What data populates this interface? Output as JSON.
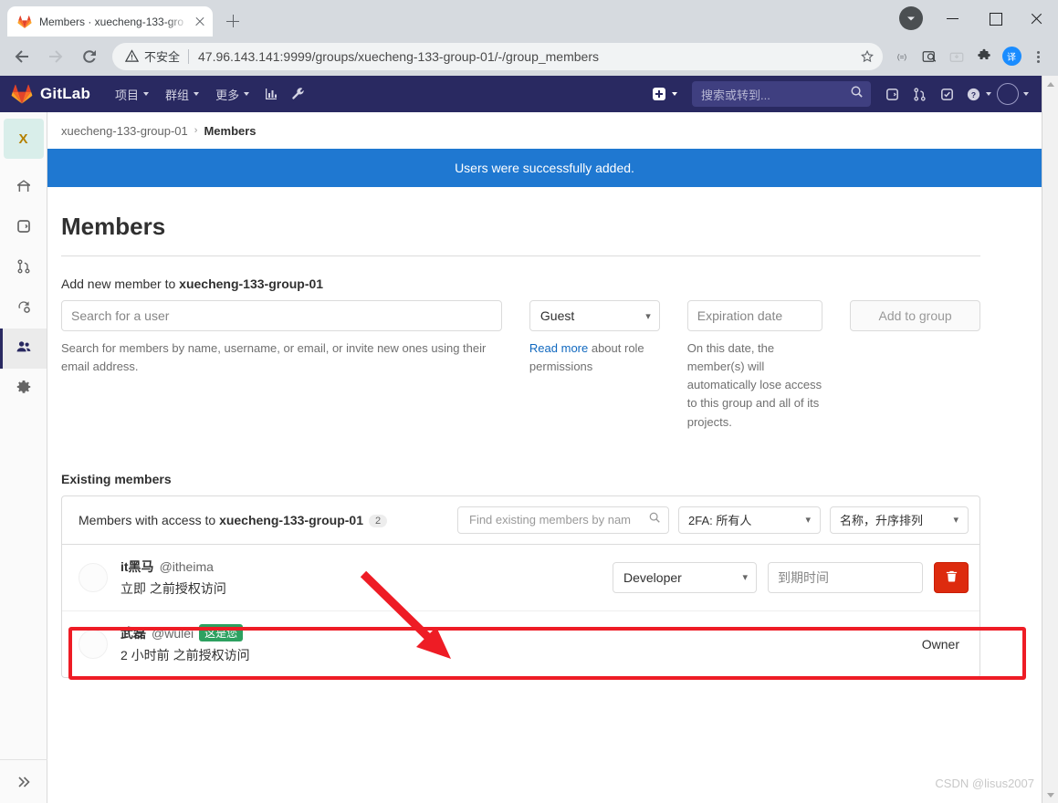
{
  "browser": {
    "tab": {
      "title": "Members · xuecheng-133-gro",
      "favicon": "gitlab-icon",
      "close": "close-icon"
    },
    "new_tab": "new-tab-icon",
    "window_controls": {
      "minimize": "minimize-icon",
      "maximize": "maximize-icon",
      "close": "close-icon"
    },
    "toolbar": {
      "back": "back-arrow-icon",
      "forward": "forward-arrow-icon",
      "reload": "reload-icon",
      "security_icon": "not-secure-warning-icon",
      "security_label": "不安全",
      "url": "47.96.143.141:9999/groups/xuecheng-133-group-01/-/group_members",
      "bookmark": "star-icon",
      "extensions": [
        "equalizer-icon",
        "screenshot-icon",
        "download-icon",
        "puzzle-icon",
        "translate-badge-icon"
      ],
      "menu": "kebab-menu-icon"
    }
  },
  "gitlab_nav": {
    "brand": "GitLab",
    "items": [
      {
        "label": "项目",
        "caret": true
      },
      {
        "label": "群组",
        "caret": true
      },
      {
        "label": "更多",
        "caret": true
      }
    ],
    "icon_buttons": [
      "analytics-icon",
      "wrench-icon"
    ],
    "create_new": "plus-icon",
    "search_placeholder": "搜索或转到...",
    "right_icons": [
      "issues-icon",
      "merge-requests-icon",
      "todos-icon",
      "help-icon"
    ],
    "avatar": "user-avatar"
  },
  "sidebar": {
    "context_initial": "X",
    "items": [
      {
        "name": "group-overview",
        "icon": "home-icon",
        "active": false
      },
      {
        "name": "issues",
        "icon": "issues-icon",
        "active": false
      },
      {
        "name": "merge-requests",
        "icon": "merge-request-icon",
        "active": false
      },
      {
        "name": "ci-cd",
        "icon": "pipeline-icon",
        "active": false
      },
      {
        "name": "members",
        "icon": "users-icon",
        "active": true
      },
      {
        "name": "settings",
        "icon": "gear-icon",
        "active": false
      }
    ],
    "collapse": "collapse-sidebar-icon"
  },
  "breadcrumb": {
    "group": "xuecheng-133-group-01",
    "separator": "›",
    "current": "Members"
  },
  "flash": {
    "message": "Users were successfully added."
  },
  "page": {
    "title": "Members",
    "add_member": {
      "label_prefix": "Add new member to ",
      "label_group": "xuecheng-133-group-01",
      "search_placeholder": "Search for a user",
      "search_value": "",
      "search_help": "Search for members by name, username, or email, or invite new ones using their email address.",
      "role_value": "Guest",
      "role_help_link": "Read more",
      "role_help_text": " about role permissions",
      "expiration_placeholder": "Expiration date",
      "expiration_value": "",
      "expiration_help": "On this date, the member(s) will automatically lose access to this group and all of its projects.",
      "submit_label": "Add to group"
    },
    "existing": {
      "section_title": "Existing members",
      "header_prefix": "Members with access to ",
      "header_group": "xuecheng-133-group-01",
      "count": "2",
      "find_placeholder": "Find existing members by nam",
      "find_value": "",
      "filter_2fa": "2FA: 所有人",
      "sort": "名称，升序排列",
      "members": [
        {
          "name": "it黑马",
          "handle": "@itheima",
          "you_badge": "",
          "access_text": "立即 之前授权访问",
          "role": "Developer",
          "expiration_placeholder": "到期时间",
          "expiration_value": "",
          "delete_icon": "trash-icon",
          "role_static": ""
        },
        {
          "name": "武磊",
          "handle": "@wulei",
          "you_badge": "这是您",
          "access_text": "2 小时前 之前授权访问",
          "role": "",
          "expiration_placeholder": "",
          "expiration_value": "",
          "delete_icon": "",
          "role_static": "Owner"
        }
      ]
    }
  },
  "watermark": "CSDN @lisus2007",
  "colors": {
    "gitlab_navy": "#292961",
    "flash_blue": "#1f78d1",
    "danger_red": "#dd2b0e",
    "annotation_red": "#ee1c25",
    "link_blue": "#1068bf",
    "badge_green": "#2da160"
  }
}
